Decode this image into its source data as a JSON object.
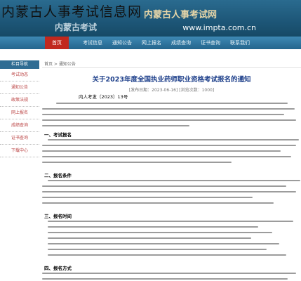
{
  "overlay": {
    "title": "内蒙古人事考试信息网"
  },
  "banner": {
    "brand": "内蒙古考试",
    "site_name": "内蒙古人事考试网",
    "url": "www.impta.com.cn"
  },
  "nav": {
    "home": "首页",
    "items": [
      "考试信息",
      "通知公告",
      "网上报名",
      "成绩查询",
      "证书查询",
      "联系我们"
    ]
  },
  "sidebar": {
    "header": "栏目导航",
    "items": [
      "考试动态",
      "通知公告",
      "政策法规",
      "网上报名",
      "成绩查询",
      "证书查询",
      "下载中心"
    ]
  },
  "article": {
    "breadcrumb": "首页 > 通知公告",
    "title": "关于2023年度全国执业药师职业资格考试报名的通知",
    "meta": "[发布日期：2023-06-16] [浏览次数：1000]",
    "doc_no": "内人考发〔2023〕13号",
    "sections": [
      "一、考试报名",
      "二、报名条件",
      "三、报名时间",
      "四、报名方式"
    ]
  }
}
